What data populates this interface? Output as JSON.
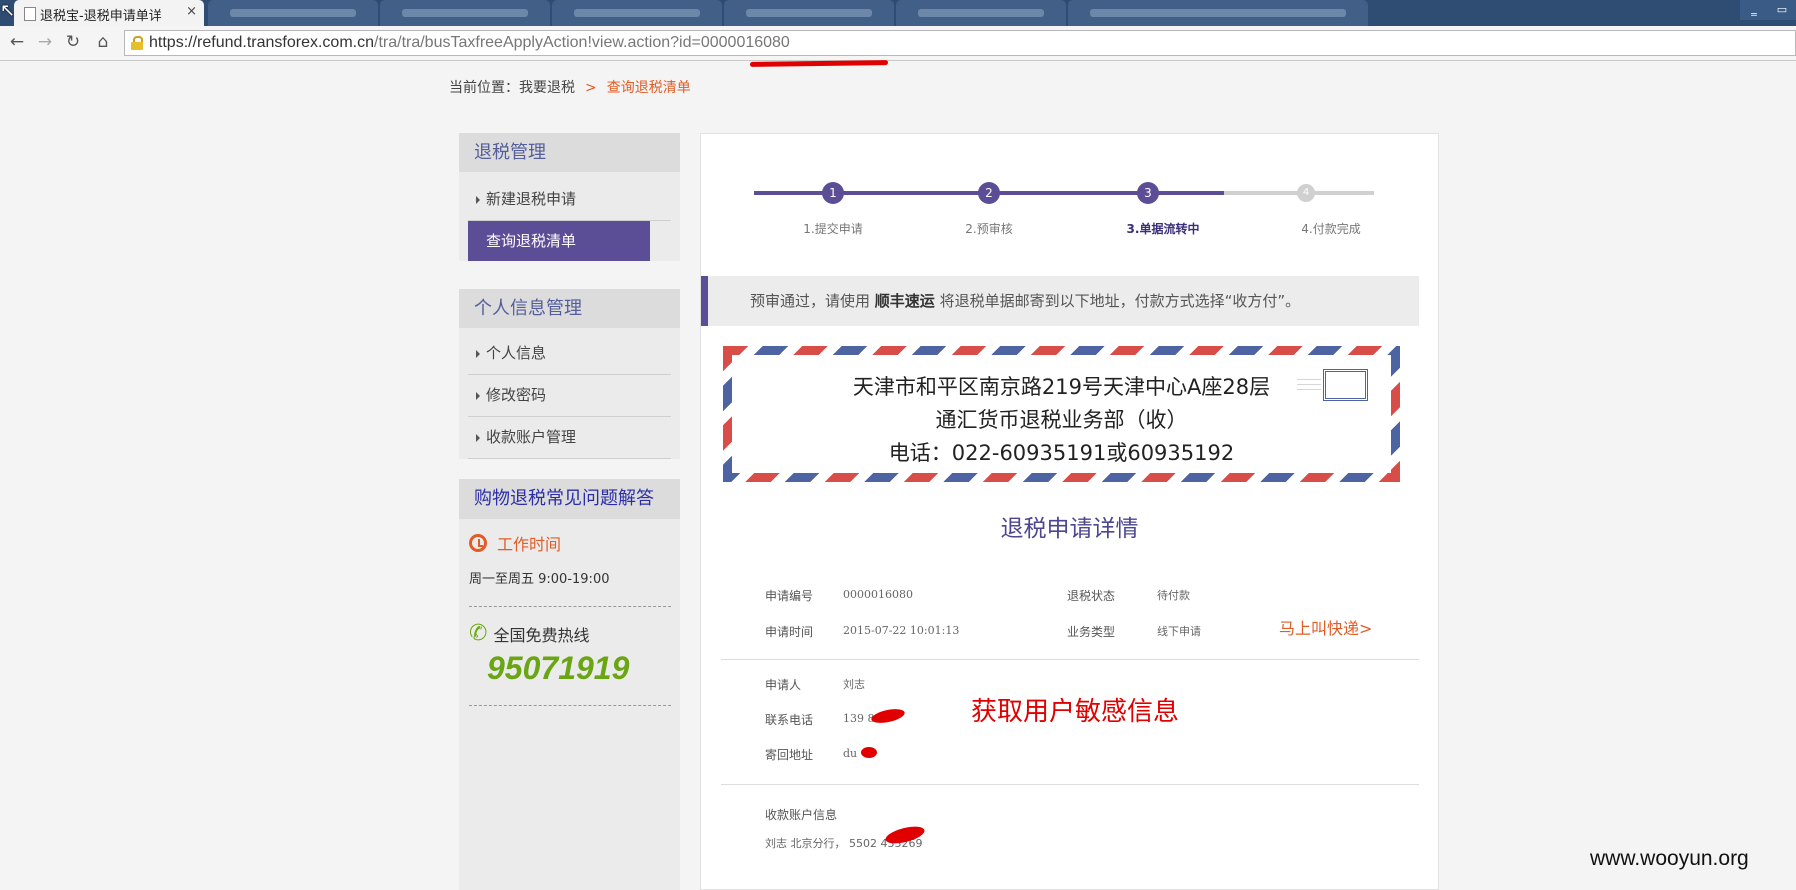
{
  "browser": {
    "active_tab_title": "退税宝-退税申请单详",
    "url_host": "https://refund.transforex.com.cn",
    "url_path": "/tra/tra/busTaxfreeApplyAction!view.action?id=0000016080"
  },
  "breadcrumb": {
    "prefix": "当前位置：我要退税",
    "separator": ">",
    "current": "查询退税清单"
  },
  "sidebar": {
    "refund_mgmt_title": "退税管理",
    "refund_items": [
      "新建退税申请",
      "查询退税清单"
    ],
    "personal_title": "个人信息管理",
    "personal_items": [
      "个人信息",
      "修改密码",
      "收款账户管理"
    ],
    "faq_title": "购物退税常见问题解答",
    "worktime_label": "工作时间",
    "worktime_hours": "周一至周五 9:00-19:00",
    "hotline_label": "全国免费热线",
    "hotline_number": "95071919"
  },
  "steps": [
    {
      "num": "1",
      "label": "1.提交申请",
      "state": "done"
    },
    {
      "num": "2",
      "label": "2.预审核",
      "state": "done"
    },
    {
      "num": "3",
      "label": "3.单据流转中",
      "state": "current"
    },
    {
      "num": "4",
      "label": "4.付款完成",
      "state": "todo"
    }
  ],
  "notice": {
    "before": "预审通过，请使用",
    "courier": "顺丰速运",
    "after": "将退税单据邮寄到以下地址，付款方式选择“收方付”。"
  },
  "envelope": {
    "line1": "天津市和平区南京路219号天津中心A座28层",
    "line2": "通汇货币退税业务部（收）",
    "line3": "电话：022-60935191或60935192"
  },
  "detail": {
    "title": "退税申请详情",
    "apply_no_label": "申请编号",
    "apply_no": "0000016080",
    "status_label": "退税状态",
    "status": "待付款",
    "apply_time_label": "申请时间",
    "apply_time": "2015-07-22 10:01:13",
    "biz_type_label": "业务类型",
    "biz_type": "线下申请",
    "express_link": "马上叫快递>",
    "applicant_label": "申请人",
    "applicant": "刘志",
    "phone_label": "联系电话",
    "phone": "139        862",
    "address_label": "寄回地址",
    "address": "du",
    "account_label": "收款账户信息",
    "account": "刘志  北京分行，  5502          433269"
  },
  "annotation": "获取用户敏感信息",
  "watermark": "www.wooyun.org",
  "colors": {
    "brand_purple": "#5b4d96",
    "accent_orange": "#e25c26",
    "hotline_green": "#6aa514",
    "redaction_red": "#e00000"
  }
}
